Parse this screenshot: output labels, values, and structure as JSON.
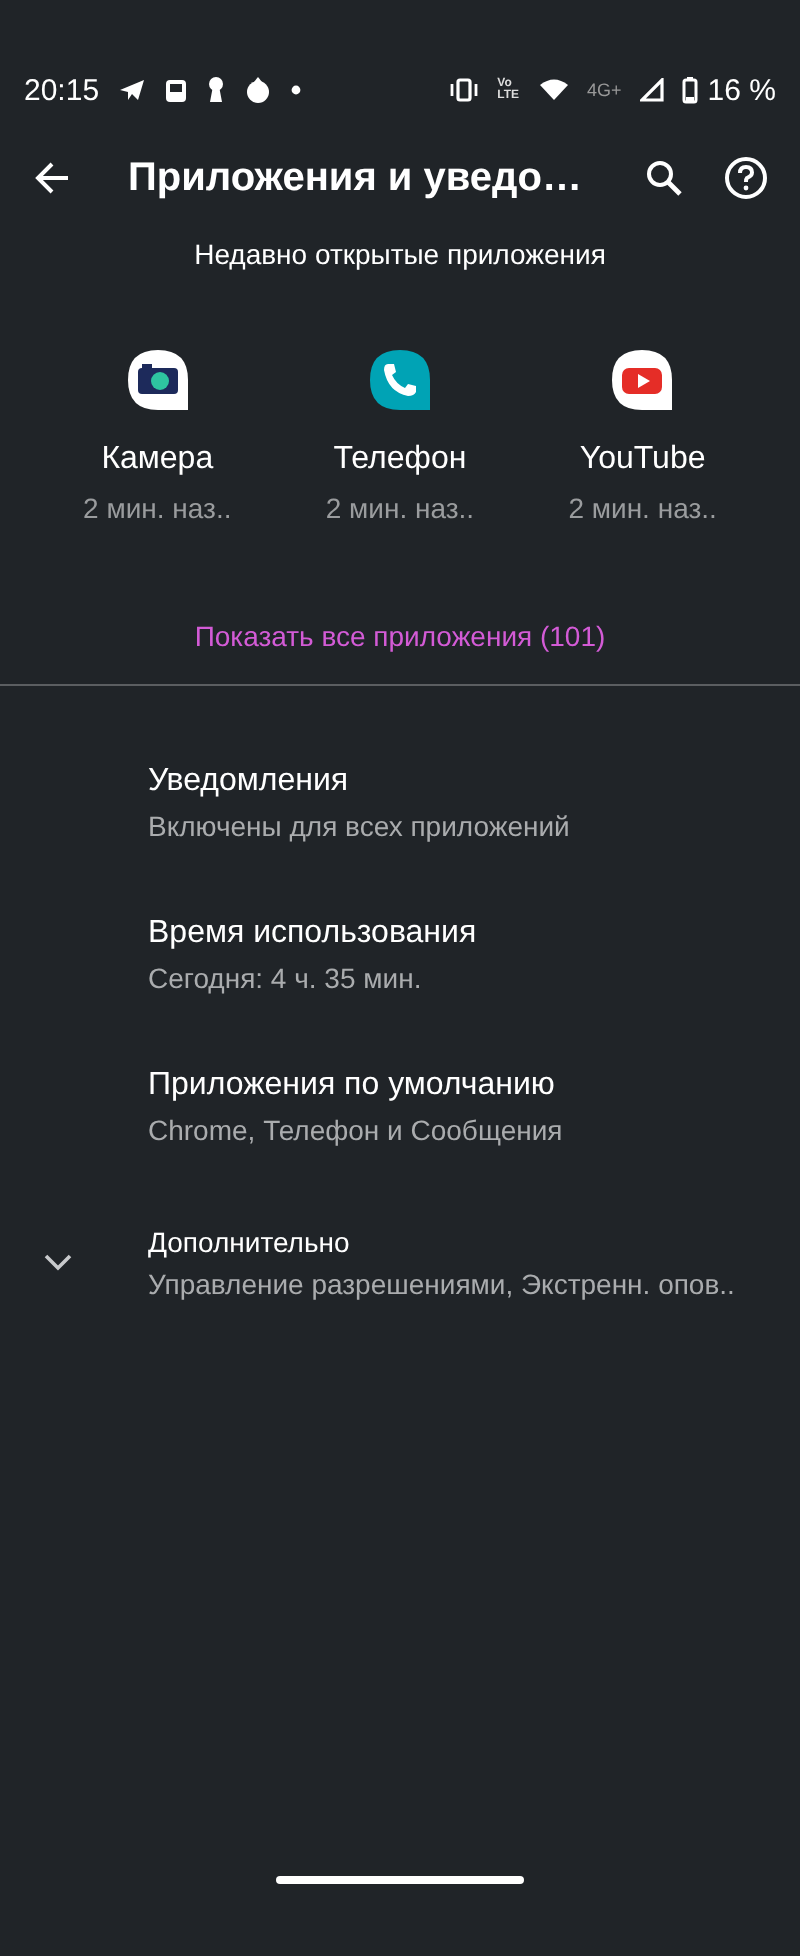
{
  "status_bar": {
    "time": "20:15",
    "volte": [
      "Vo",
      "LTE"
    ],
    "network": "4G+",
    "battery": "16 %"
  },
  "toolbar": {
    "title": "Приложения и уведо…"
  },
  "recent": {
    "heading": "Недавно открытые приложения",
    "apps": [
      {
        "kind": "camera",
        "name": "Камера",
        "time": "2 мин. наз.."
      },
      {
        "kind": "phone",
        "name": "Телефон",
        "time": "2 мин. наз.."
      },
      {
        "kind": "youtube",
        "name": "YouTube",
        "time": "2 мин. наз.."
      }
    ],
    "show_all": "Показать все приложения (101)"
  },
  "settings": [
    {
      "kind": "plain",
      "title": "Уведомления",
      "summary": "Включены для всех приложений"
    },
    {
      "kind": "plain",
      "title": "Время использования",
      "summary": "Сегодня: 4 ч. 35 мин."
    },
    {
      "kind": "plain",
      "title": "Приложения по умолчанию",
      "summary": "Chrome, Телефон и Сообщения"
    },
    {
      "kind": "advanced",
      "title": "Дополнительно",
      "summary": "Управление разрешениями, Экстренн. опов..",
      "expanded": false
    }
  ]
}
